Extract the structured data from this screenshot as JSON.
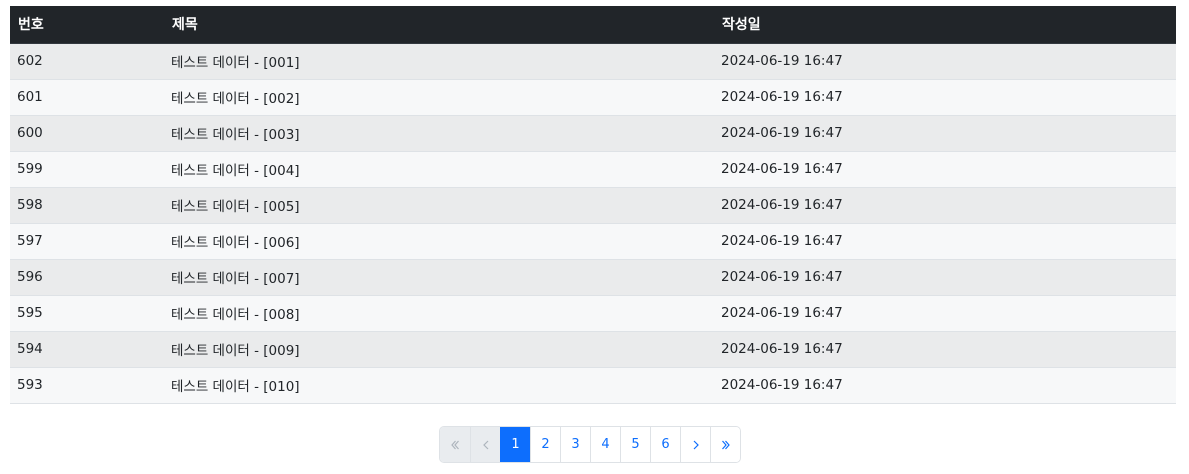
{
  "table": {
    "headers": {
      "num": "번호",
      "title": "제목",
      "date": "작성일"
    },
    "rows": [
      {
        "num": "602",
        "title": "테스트 데이터 - [001]",
        "date": "2024-06-19 16:47"
      },
      {
        "num": "601",
        "title": "테스트 데이터 - [002]",
        "date": "2024-06-19 16:47"
      },
      {
        "num": "600",
        "title": "테스트 데이터 - [003]",
        "date": "2024-06-19 16:47"
      },
      {
        "num": "599",
        "title": "테스트 데이터 - [004]",
        "date": "2024-06-19 16:47"
      },
      {
        "num": "598",
        "title": "테스트 데이터 - [005]",
        "date": "2024-06-19 16:47"
      },
      {
        "num": "597",
        "title": "테스트 데이터 - [006]",
        "date": "2024-06-19 16:47"
      },
      {
        "num": "596",
        "title": "테스트 데이터 - [007]",
        "date": "2024-06-19 16:47"
      },
      {
        "num": "595",
        "title": "테스트 데이터 - [008]",
        "date": "2024-06-19 16:47"
      },
      {
        "num": "594",
        "title": "테스트 데이터 - [009]",
        "date": "2024-06-19 16:47"
      },
      {
        "num": "593",
        "title": "테스트 데이터 - [010]",
        "date": "2024-06-19 16:47"
      }
    ]
  },
  "pagination": {
    "first_icon": "double-chevron-left-icon",
    "prev_icon": "chevron-left-icon",
    "next_icon": "chevron-right-icon",
    "last_icon": "double-chevron-right-icon",
    "pages": [
      "1",
      "2",
      "3",
      "4",
      "5",
      "6"
    ],
    "current_page": "1"
  },
  "colors": {
    "header_bg": "#212529",
    "accent": "#0d6efd",
    "row_odd": "#eaebec",
    "row_even": "#f7f8f9"
  }
}
